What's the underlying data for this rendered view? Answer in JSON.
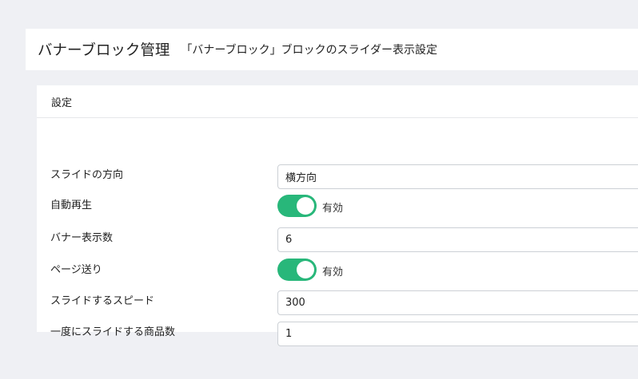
{
  "header": {
    "title": "バナーブロック管理",
    "subtitle": "「バナーブロック」ブロックのスライダー表示設定"
  },
  "card": {
    "title": "設定"
  },
  "settings": {
    "direction": {
      "label": "スライドの方向",
      "value": "横方向"
    },
    "autoplay": {
      "label": "自動再生",
      "toggle_label": "有効",
      "enabled": true
    },
    "banner_count": {
      "label": "バナー表示数",
      "value": "6"
    },
    "pagination": {
      "label": "ページ送り",
      "toggle_label": "有効",
      "enabled": true
    },
    "speed": {
      "label": "スライドするスピード",
      "value": "300"
    },
    "items_per_slide": {
      "label": "一度にスライドする商品数",
      "value": "1"
    }
  },
  "colors": {
    "toggle_on": "#28b77a",
    "background": "#eff0f4",
    "panel": "#ffffff"
  }
}
